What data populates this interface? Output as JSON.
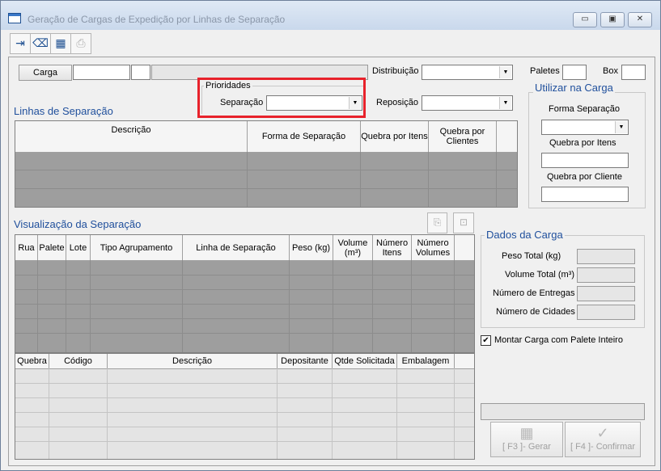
{
  "window": {
    "title": "Geração de Cargas de Expedição por Linhas de Separação",
    "icon": "window-icon",
    "controls": {
      "minimize": "▭",
      "maximize": "▣",
      "close": "✕"
    }
  },
  "toolbar": {
    "buttons": [
      {
        "icon": "exit-icon",
        "glyph": "⇥"
      },
      {
        "icon": "eraser-icon",
        "glyph": "⌫"
      },
      {
        "icon": "settings-grid-icon",
        "glyph": "▦"
      },
      {
        "icon": "print-icon",
        "glyph": "⎙"
      }
    ]
  },
  "header": {
    "carga_button": "Carga",
    "distribuicao_label": "Distribuição",
    "paletes_label": "Paletes",
    "box_label": "Box"
  },
  "prioridades": {
    "legend": "Prioridades",
    "separacao_label": "Separação",
    "reposicao_label": "Reposição"
  },
  "linhas": {
    "title": "Linhas de Separação",
    "columns": [
      "Descrição",
      "Forma de Separação",
      "Quebra por Itens",
      "Quebra por Clientes"
    ]
  },
  "utilizar": {
    "legend": "Utilizar na Carga",
    "forma_label": "Forma Separação",
    "quebra_itens_label": "Quebra por Itens",
    "quebra_cliente_label": "Quebra por Cliente"
  },
  "visualizacao": {
    "title": "Visualização da Separação",
    "columns": [
      "Rua",
      "Palete",
      "Lote",
      "Tipo Agrupamento",
      "Linha de Separação",
      "Peso (kg)",
      "Volume (m³)",
      "Número Itens",
      "Número Volumes"
    ],
    "icons": [
      "clipboard-icon",
      "folder-check-icon"
    ]
  },
  "detalhe": {
    "columns": [
      "Quebra",
      "Código",
      "Descrição",
      "Depositante",
      "Qtde Solicitada",
      "Embalagem"
    ]
  },
  "dados": {
    "legend": "Dados da Carga",
    "peso": "Peso Total (kg)",
    "volume": "Volume Total (m³)",
    "entregas": "Número de Entregas",
    "cidades": "Número de Cidades"
  },
  "montar": {
    "label": "Montar Carga com Palete Inteiro",
    "checked": "✔"
  },
  "actions": {
    "gerar": "[ F3 ]- Gerar",
    "confirmar": "[ F4 ]- Confirmar"
  }
}
